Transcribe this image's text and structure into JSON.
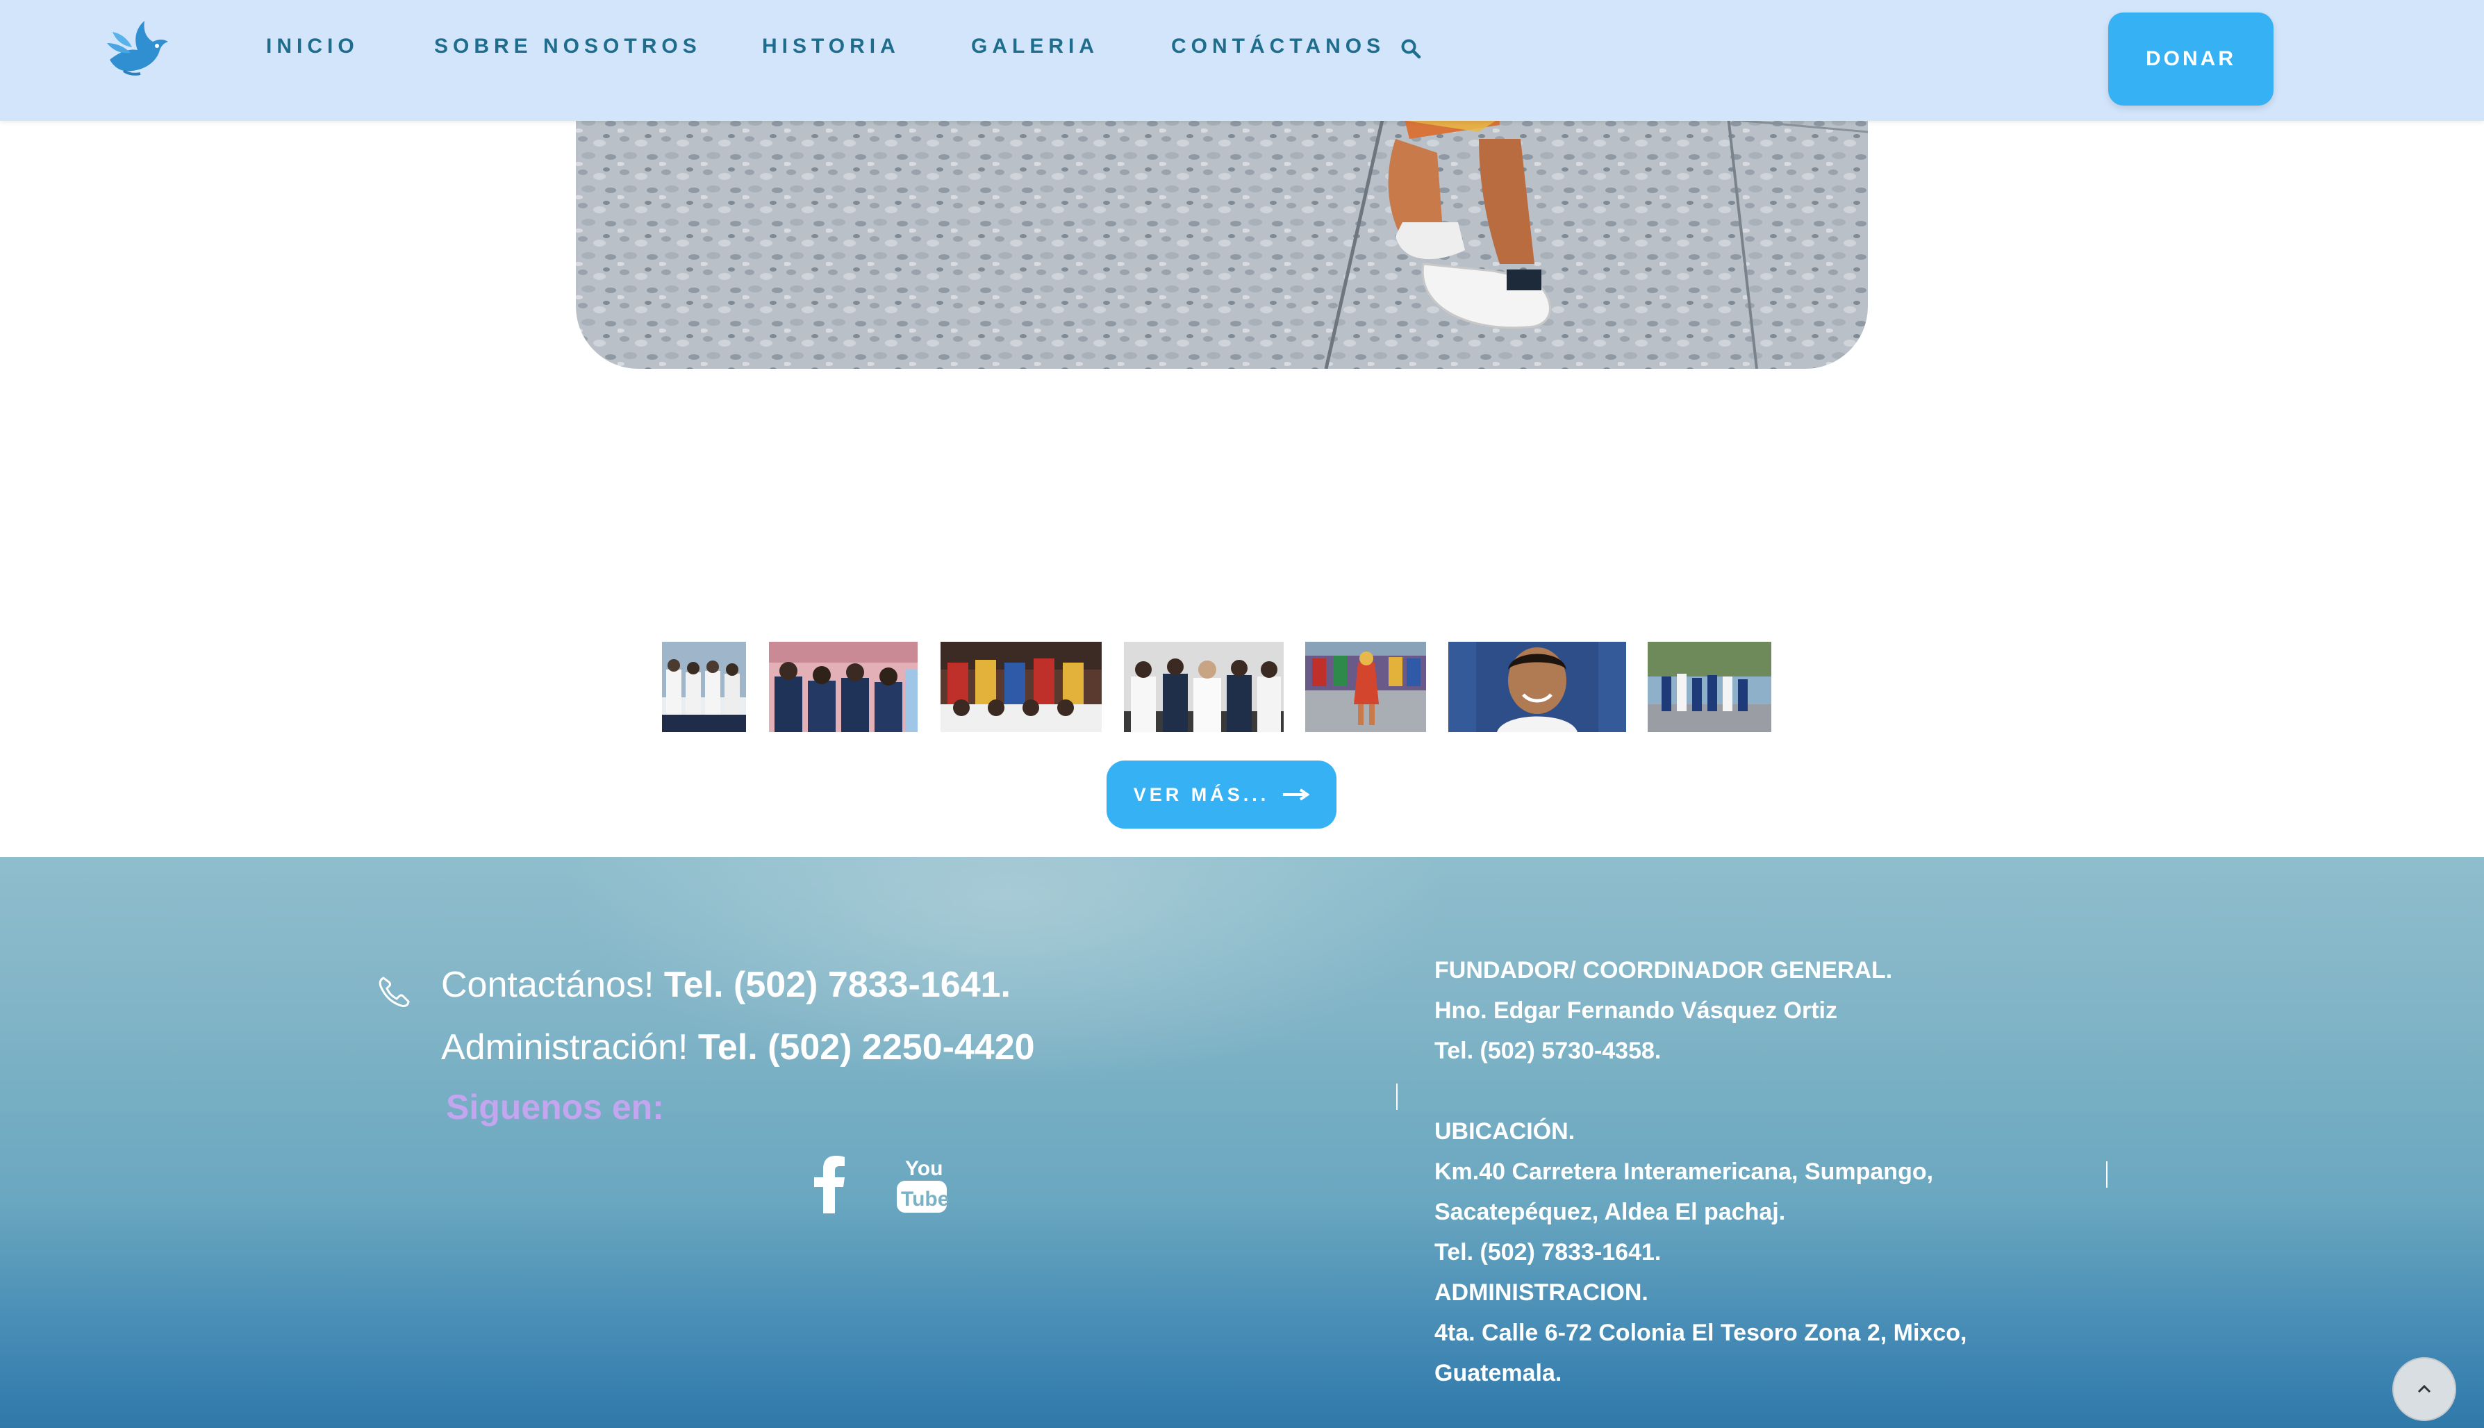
{
  "header": {
    "nav": [
      {
        "label": "INICIO"
      },
      {
        "label": "SOBRE NOSOTROS"
      },
      {
        "label": "HISTORIA"
      },
      {
        "label": "GALERIA"
      },
      {
        "label": "CONTÁCTANOS"
      }
    ],
    "donate_label": "DONAR"
  },
  "gallery": {
    "more_label": "VER MÁS..."
  },
  "footer": {
    "contact_prefix": "Contactános!",
    "contact_phone": "Tel. (502) 7833-1641.",
    "admin_prefix": "Administración!",
    "admin_phone": "Tel. (502) 2250-4420",
    "follow_label": "Siguenos en:",
    "info_lines": [
      "FUNDADOR/ COORDINADOR GENERAL.",
      "Hno. Edgar Fernando Vásquez Ortiz",
      "Tel. (502) 5730-4358.",
      "",
      "UBICACIÓN.",
      "Km.40 Carretera Interamericana, Sumpango,",
      "Sacatepéquez, Aldea El pachaj.",
      "Tel. (502) 7833-1641.",
      "ADMINISTRACION.",
      "4ta. Calle 6-72 Colonia El Tesoro Zona 2, Mixco,",
      "Guatemala."
    ]
  },
  "colors": {
    "header_bg": "#d3e5fb",
    "nav_text": "#1f6d8c",
    "accent": "#35b1f4",
    "follow_text": "#c3a6ef"
  },
  "icons": [
    "dove-logo-icon",
    "search-icon",
    "arrow-right-icon",
    "phone-icon",
    "facebook-icon",
    "youtube-icon",
    "chevron-up-icon"
  ]
}
